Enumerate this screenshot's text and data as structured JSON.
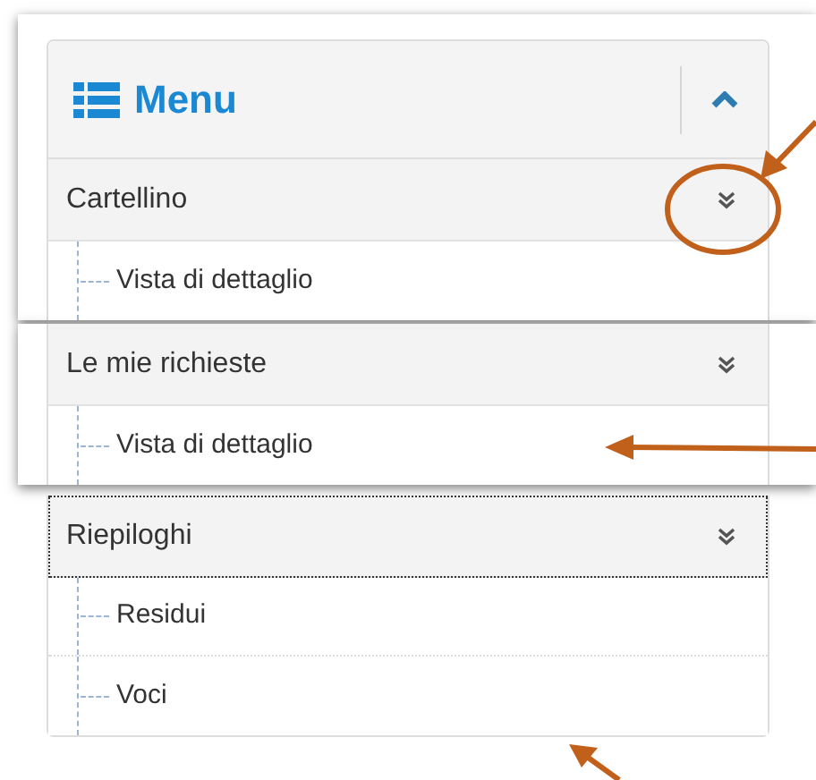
{
  "menu": {
    "title": "Menu",
    "sections": [
      {
        "title": "Cartellino",
        "focused": false,
        "children": [
          {
            "label": "Vista di dettaglio"
          }
        ]
      },
      {
        "title": "Le mie richieste",
        "focused": false,
        "children": [
          {
            "label": "Vista di dettaglio"
          }
        ]
      },
      {
        "title": "Riepiloghi",
        "focused": true,
        "children": [
          {
            "label": "Residui"
          },
          {
            "label": "Voci"
          }
        ]
      }
    ]
  }
}
